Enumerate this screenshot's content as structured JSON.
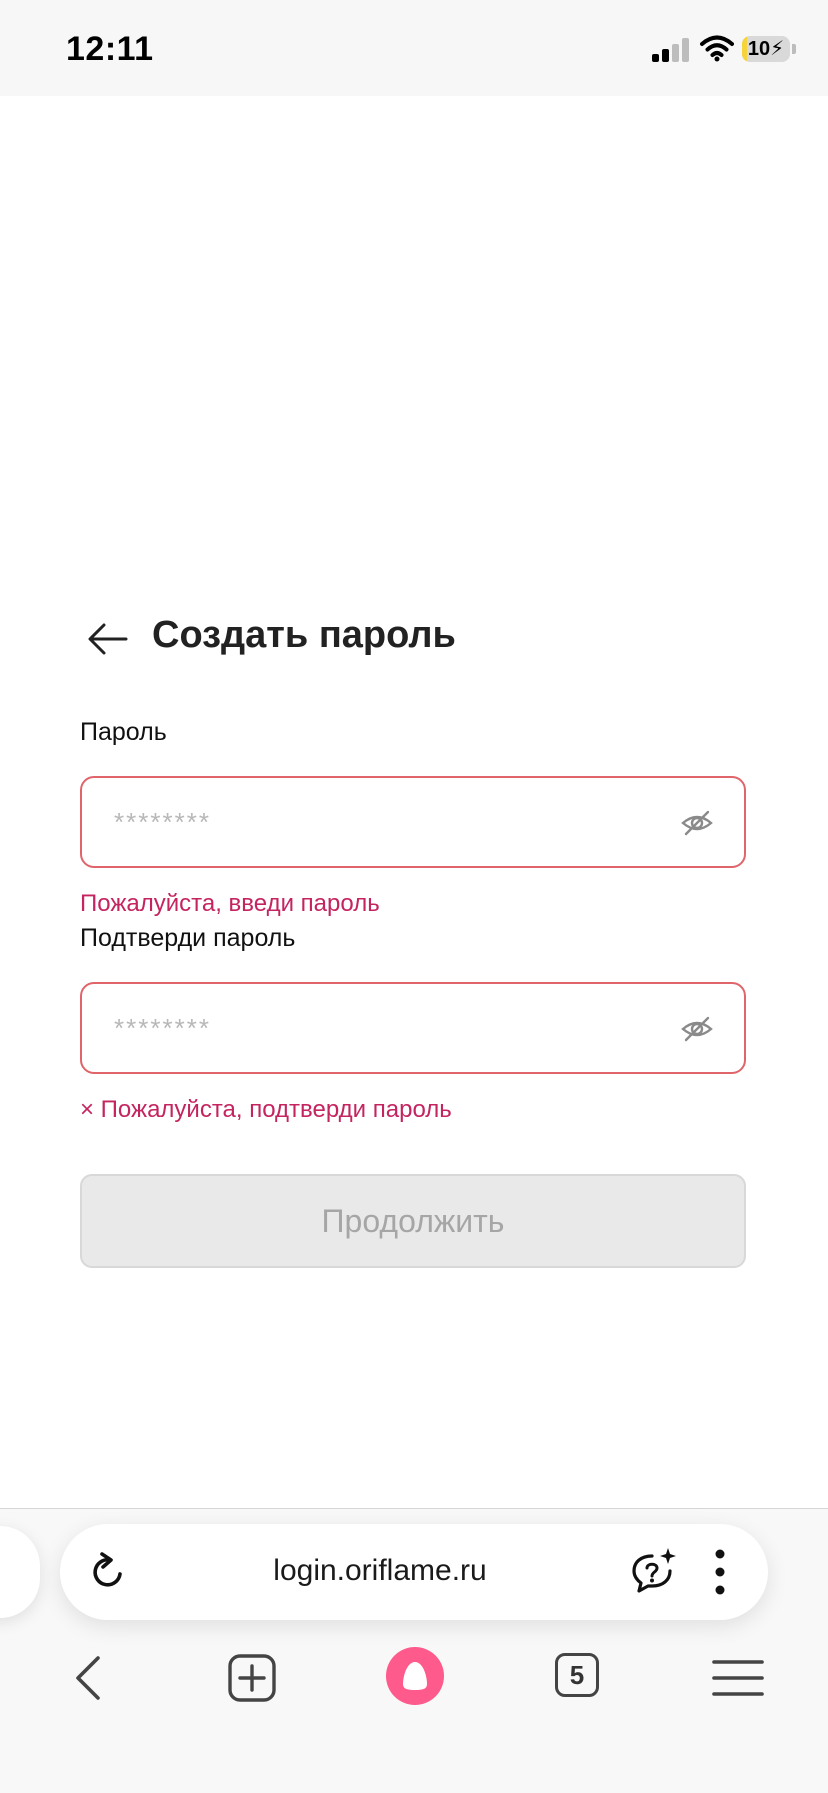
{
  "status_bar": {
    "time": "12:11",
    "battery": "10",
    "battery_level": 0.1
  },
  "form": {
    "title": "Создать пароль",
    "password": {
      "label": "Пароль",
      "placeholder": "********",
      "value": "",
      "error": "Пожалуйста, введи пароль"
    },
    "confirm_password": {
      "label": "Подтверди пароль",
      "placeholder": "********",
      "value": "",
      "error": "× Пожалуйста, подтверди пароль"
    },
    "continue_button": {
      "label": "Продолжить",
      "disabled": true
    }
  },
  "browser": {
    "url": "login.oriflame.ru",
    "tabs_count": "5"
  },
  "colors": {
    "error_border": "#e0656b",
    "error_text": "#c4245f",
    "disabled_button_bg": "#e9e9e9",
    "disabled_button_text": "#a6a6a6",
    "alice_pink": "#ff5a8c",
    "battery_yellow": "#f5d53b"
  },
  "icons": [
    "cellular-signal-icon",
    "wifi-icon",
    "battery-icon",
    "arrow-left-icon",
    "eye-off-icon",
    "reload-icon",
    "assistant-sparkle-icon",
    "more-vertical-icon",
    "chevron-left-icon",
    "new-tab-plus-icon",
    "alice-icon",
    "tabs-count-icon",
    "menu-hamburger-icon"
  ]
}
